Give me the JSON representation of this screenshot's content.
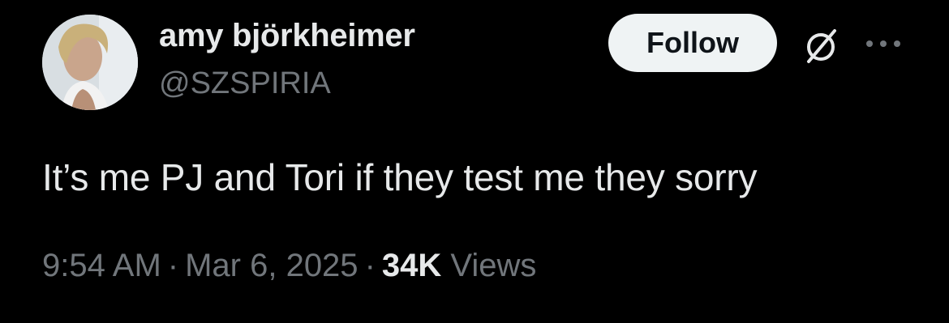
{
  "author": {
    "display_name": "amy björkheimer",
    "handle": "@SZSPIRIA"
  },
  "actions": {
    "follow_label": "Follow",
    "grok_icon": "grok-slash-circle-icon",
    "more_icon": "more-horizontal-icon"
  },
  "tweet": {
    "text": "It’s me PJ and Tori if they test me they sorry"
  },
  "meta": {
    "time": "9:54 AM",
    "separator": "·",
    "date": "Mar 6, 2025",
    "views_count": "34K",
    "views_label": "Views"
  },
  "colors": {
    "background": "#000000",
    "primary_text": "#e7e9ea",
    "secondary_text": "#71767b",
    "follow_button_bg": "#eff3f4",
    "follow_button_text": "#0f1419"
  }
}
